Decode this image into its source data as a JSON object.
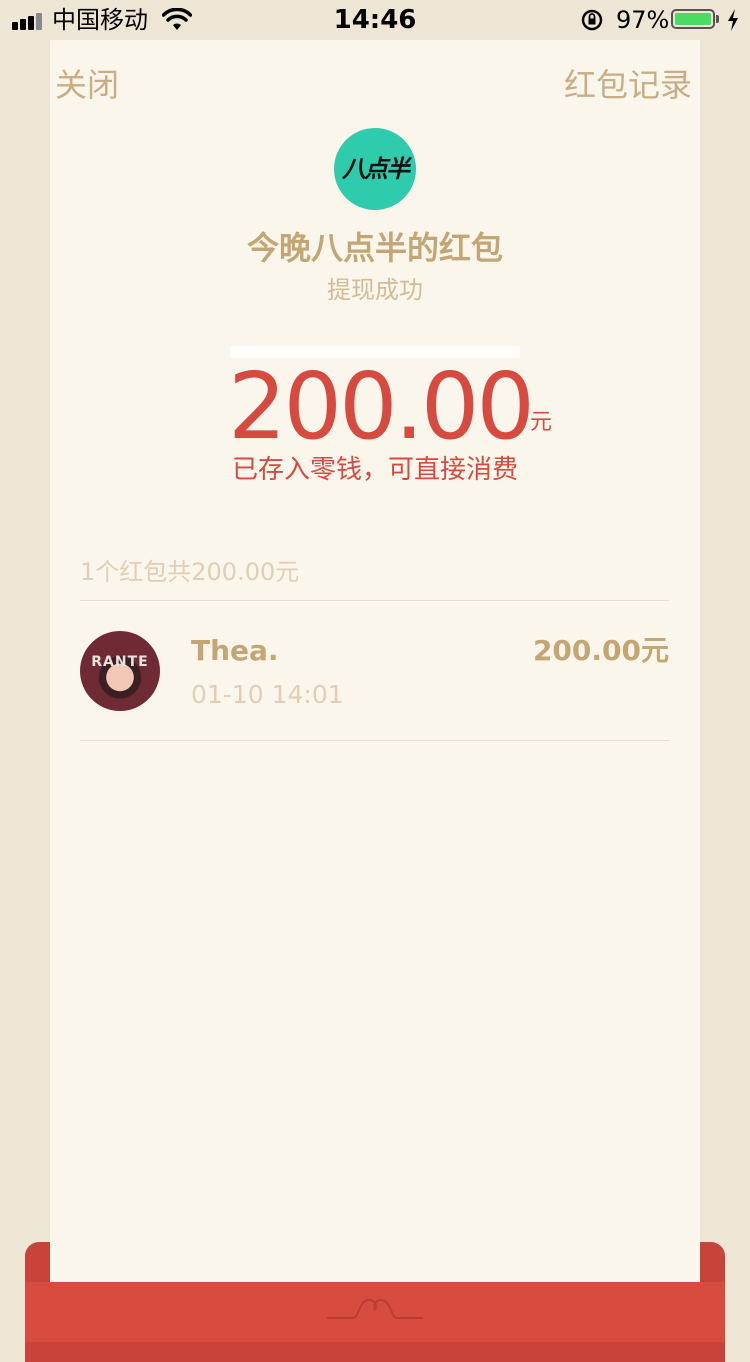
{
  "status_bar": {
    "carrier": "中国移动",
    "time": "14:46",
    "battery": "97%",
    "battery_level": 0.97
  },
  "header": {
    "close_label": "关闭",
    "records_label": "红包记录"
  },
  "packet": {
    "logo_text": "八点半",
    "sender_title": "今晚八点半的红包",
    "status": "提现成功",
    "amount": "200.00",
    "unit": "元",
    "note": "已存入零钱，可直接消费"
  },
  "summary": "1个红包共200.00元",
  "records": [
    {
      "name": "Thea.",
      "time": "01-10 14:01",
      "amount": "200.00元"
    }
  ],
  "colors": {
    "background": "#ede6d5",
    "card": "#faf6ec",
    "gold": "#c4a574",
    "red": "#d64a40",
    "logo": "#2ecbac",
    "battery": "#4cd964"
  }
}
